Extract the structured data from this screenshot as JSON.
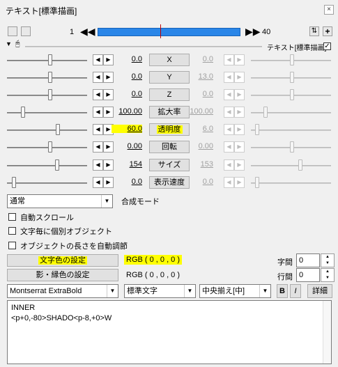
{
  "window": {
    "title": "テキスト[標準描画]",
    "close_label": "×"
  },
  "timeline": {
    "start_frame": "1",
    "end_frame": "40"
  },
  "object_header": {
    "label": "テキスト[標準描画]",
    "checked": true
  },
  "tracks": [
    {
      "name": "X",
      "left_value": "0.0",
      "right_value": "0.0"
    },
    {
      "name": "Y",
      "left_value": "0.0",
      "right_value": "13.0"
    },
    {
      "name": "Z",
      "left_value": "0.0",
      "right_value": "0.0"
    },
    {
      "name": "拡大率",
      "left_value": "100.00",
      "right_value": "100.00"
    },
    {
      "name": "透明度",
      "left_value": "60.0",
      "right_value": "6.0"
    },
    {
      "name": "回転",
      "left_value": "0.00",
      "right_value": "0.00"
    },
    {
      "name": "サイズ",
      "left_value": "154",
      "right_value": "153"
    },
    {
      "name": "表示速度",
      "left_value": "0.0",
      "right_value": "0.0"
    }
  ],
  "blend": {
    "value": "通常",
    "label": "合成モード"
  },
  "options": [
    {
      "label": "自動スクロール",
      "checked": false
    },
    {
      "label": "文字毎に個別オブジェクト",
      "checked": false
    },
    {
      "label": "オブジェクトの長さを自動調節",
      "checked": false
    }
  ],
  "text_color": {
    "button": "文字色の設定",
    "value": "RGB ( 0 , 0 , 0 )"
  },
  "shadow_color": {
    "button": "影・縁色の設定",
    "value": "RGB ( 0 , 0 , 0 )"
  },
  "spacing": {
    "char_label": "字間",
    "char_value": "0",
    "line_label": "行間",
    "line_value": "0"
  },
  "font": {
    "family": "Montserrat ExtraBold",
    "style": "標準文字",
    "align": "中央揃え[中]",
    "bold_label": "B",
    "italic_label": "I",
    "detail_label": "詳細"
  },
  "text_content": "INNER\n<p+0,-80>SHADO<p-8,+0>W",
  "colors": {
    "highlight": "#ffff00",
    "timeline": "#2a86e8",
    "cursor": "#c00000"
  }
}
